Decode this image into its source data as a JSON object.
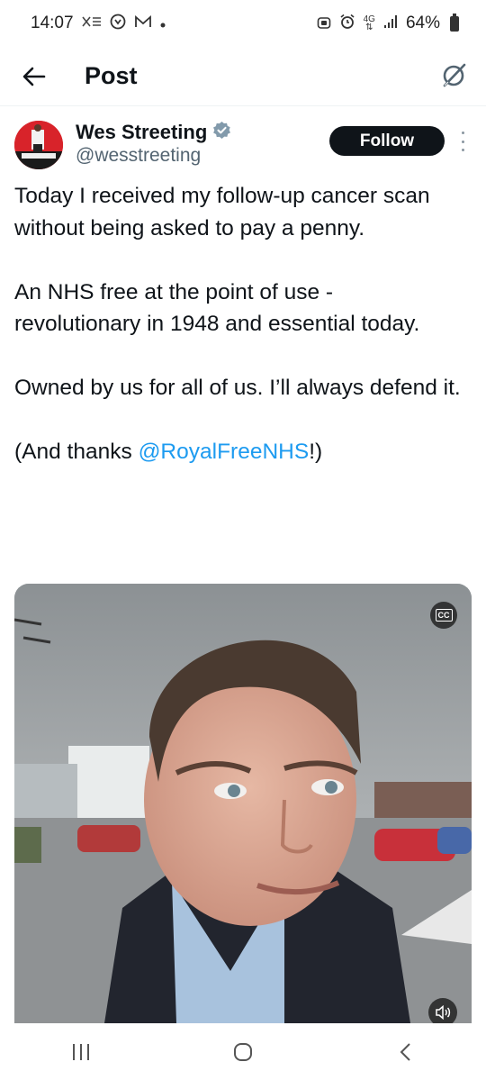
{
  "status_bar": {
    "time": "14:07",
    "battery": "64%",
    "network": "4G",
    "left_icons": [
      "notification-icon",
      "circle-icon",
      "gmail-icon",
      "dot-icon"
    ],
    "right_icons": [
      "lock-icon",
      "alarm-icon",
      "4g-icon",
      "signal-icon",
      "battery-icon"
    ]
  },
  "app_bar": {
    "title": "Post",
    "back_icon": "arrow-left-icon",
    "grok_icon": "grok-icon"
  },
  "author": {
    "name": "Wes Streeting",
    "handle": "@wesstreeting",
    "verified": true,
    "verified_color": "#829aab",
    "follow_label": "Follow"
  },
  "tweet": {
    "paragraph_1": "Today I received my follow-up cancer scan without being asked to pay a penny.",
    "paragraph_2": "An NHS free at the point of use - revolutionary in 1948 and essential today.",
    "paragraph_3": "Owned by us for all of us. I’ll always defend it.",
    "paragraph_4_prefix": "(And thanks ",
    "paragraph_4_mention": "@RoyalFreeNHS",
    "paragraph_4_suffix": "!)"
  },
  "media": {
    "type": "video",
    "cc_label": "CC",
    "volume_icon": "speaker-icon"
  },
  "colors": {
    "accent": "#1d9bf0",
    "text": "#0f1419",
    "secondary_text": "#536471",
    "follow_button": "#0f1419"
  },
  "nav_bar": {
    "buttons": [
      "recents-icon",
      "home-icon",
      "back-icon"
    ]
  }
}
